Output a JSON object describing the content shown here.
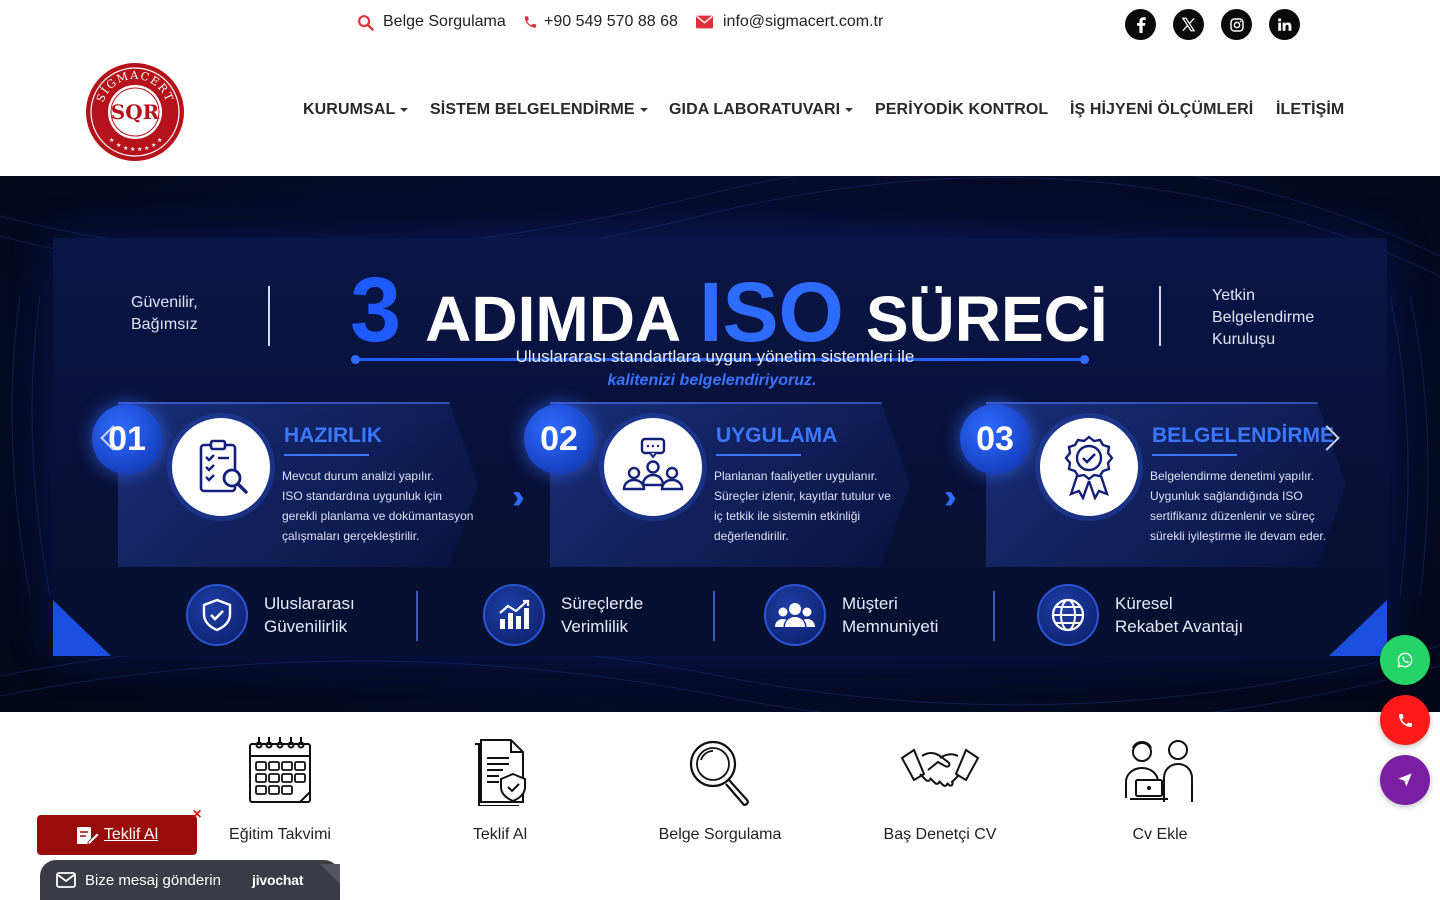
{
  "topbar": {
    "belge_sorgulama": "Belge Sorgulama",
    "phone": "+90 549 570 88 68",
    "email": "info@sigmacert.com.tr",
    "social": [
      "facebook-icon",
      "x-icon",
      "instagram-icon",
      "linkedin-icon"
    ]
  },
  "logo": {
    "ring_text": "SİGMACERT",
    "center_text": "SQR"
  },
  "nav": {
    "items": [
      {
        "label": "KURUMSAL",
        "dropdown": true
      },
      {
        "label": "SİSTEM BELGELENDİRME",
        "dropdown": true
      },
      {
        "label": "GIDA LABORATUVARI",
        "dropdown": true
      },
      {
        "label": "PERİYODİK KONTROL",
        "dropdown": false
      },
      {
        "label": "İŞ HİJYENİ ÖLÇÜMLERİ",
        "dropdown": false
      },
      {
        "label": "İLETİŞİM",
        "dropdown": false
      }
    ]
  },
  "hero": {
    "tag_left": "Güvenilir,\nBağımsız",
    "tag_right": "Yetkin\nBelgelendirme\nKuruluşu",
    "headline_num": "3",
    "headline_a": "ADIMDA",
    "headline_iso": "ISO",
    "headline_s": "SÜRECİ",
    "subtitle": "Uluslararası standartlara uygun yönetim sistemleri ile",
    "subtitle_accent": "kalitenizi belgelendiriyoruz.",
    "steps": [
      {
        "num": "01",
        "title": "HAZIRLIK",
        "desc": "Mevcut durum analizi yapılır.\nISO standardına uygunluk için\ngerekli planlama ve dokümantasyon\nçalışmaları gerçekleştirilir.",
        "icon": "clipboard-search-icon"
      },
      {
        "num": "02",
        "title": "UYGULAMA",
        "desc": "Planlanan faaliyetler uygulanır.\nSüreçler izlenir, kayıtlar tutulur ve\niç tetkik ile sistemin etkinliği\ndeğerlendirilir.",
        "icon": "team-chat-icon"
      },
      {
        "num": "03",
        "title": "BELGELENDİRME",
        "desc": "Belgelendirme denetimi yapılır.\nUygunluk sağlandığında ISO\nsertifikanız düzenlenir ve süreç\nsürekli iyileştirme ile devam eder.",
        "icon": "award-badge-icon"
      }
    ],
    "features": [
      {
        "label": "Uluslararası\nGüvenilirlik",
        "icon": "shield-check-icon"
      },
      {
        "label": "Süreçlerde\nVerimlilik",
        "icon": "bar-chart-icon"
      },
      {
        "label": "Müşteri\nMemnuniyeti",
        "icon": "users-icon"
      },
      {
        "label": "Küresel\nRekabet Avantajı",
        "icon": "globe-icon"
      }
    ],
    "colors": {
      "accent": "#2e6bff",
      "bg": "#060c2c"
    }
  },
  "quicklinks": [
    {
      "label": "Eğitim Takvimi",
      "icon": "calendar-icon"
    },
    {
      "label": "Teklif Al",
      "icon": "document-shield-icon"
    },
    {
      "label": "Belge Sorgulama",
      "icon": "magnifier-icon"
    },
    {
      "label": "Baş Denetçi CV",
      "icon": "handshake-icon"
    },
    {
      "label": "Cv Ekle",
      "icon": "people-laptop-icon"
    }
  ],
  "floating": {
    "teklif_label": "Teklif Al",
    "close_glyph": "×",
    "chat_label": "Bize mesaj gönderin",
    "chat_brand": "jivochat",
    "fab_icons": [
      "whatsapp-icon",
      "phone-icon",
      "navigation-icon"
    ],
    "fab_colors": [
      "#25d366",
      "#ff1a1a",
      "#7b1fa2"
    ]
  }
}
